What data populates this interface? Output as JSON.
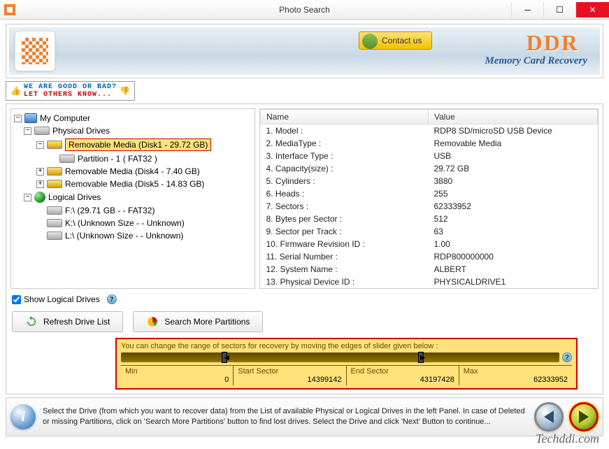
{
  "window": {
    "title": "Photo Search"
  },
  "banner": {
    "contact": "Contact us",
    "brand": "DDR",
    "subtitle": "Memory Card Recovery"
  },
  "feedback": {
    "line1": "WE ARE GOOD OR BAD?",
    "line2": "LET OTHERS KNOW..."
  },
  "tree": {
    "root": "My Computer",
    "physical": "Physical Drives",
    "disk1": "Removable Media (Disk1 - 29.72 GB)",
    "part1": "Partition - 1 ( FAT32 )",
    "disk4": "Removable Media (Disk4 - 7.40 GB)",
    "disk5": "Removable Media (Disk5 - 14.83 GB)",
    "logical": "Logical Drives",
    "f": "F:\\ (29.71 GB  -  - FAT32)",
    "k": "K:\\ (Unknown Size  -  - Unknown)",
    "l": "L:\\ (Unknown Size  -  - Unknown)"
  },
  "details": {
    "headers": {
      "name": "Name",
      "value": "Value"
    },
    "rows": [
      {
        "n": "1. Model :",
        "v": "RDP8 SD/microSD USB Device"
      },
      {
        "n": "2. MediaType :",
        "v": "Removable Media"
      },
      {
        "n": "3. Interface Type :",
        "v": "USB"
      },
      {
        "n": "4. Capacity(size) :",
        "v": "29.72 GB"
      },
      {
        "n": "5. Cylinders :",
        "v": "3880"
      },
      {
        "n": "6. Heads :",
        "v": "255"
      },
      {
        "n": "7. Sectors :",
        "v": "62333952"
      },
      {
        "n": "8. Bytes per Sector :",
        "v": "512"
      },
      {
        "n": "9. Sector per Track :",
        "v": "63"
      },
      {
        "n": "10. Firmware Revision ID :",
        "v": "1.00"
      },
      {
        "n": "11. Serial Number :",
        "v": "RDP800000000"
      },
      {
        "n": "12. System Name :",
        "v": "ALBERT"
      },
      {
        "n": "13. Physical Device ID :",
        "v": "PHYSICALDRIVE1"
      }
    ]
  },
  "controls": {
    "show_logical": "Show Logical Drives",
    "refresh": "Refresh Drive List",
    "search_more": "Search More Partitions"
  },
  "slider": {
    "hint": "You can change the range of sectors for recovery by moving the edges of slider given below :",
    "min_label": "Min",
    "min_val": "0",
    "start_label": "Start Sector",
    "start_val": "14399142",
    "end_label": "End Sector",
    "end_val": "43197428",
    "max_label": "Max",
    "max_val": "62333952"
  },
  "tip": "Select the Drive (from which you want to recover data) from the List of available Physical or Logical Drives in the left Panel. In case of Deleted or missing Partitions, click on 'Search More Partitions' button to find lost drives. Select the Drive and click 'Next' Button to continue...",
  "watermark": "Techddi.com"
}
